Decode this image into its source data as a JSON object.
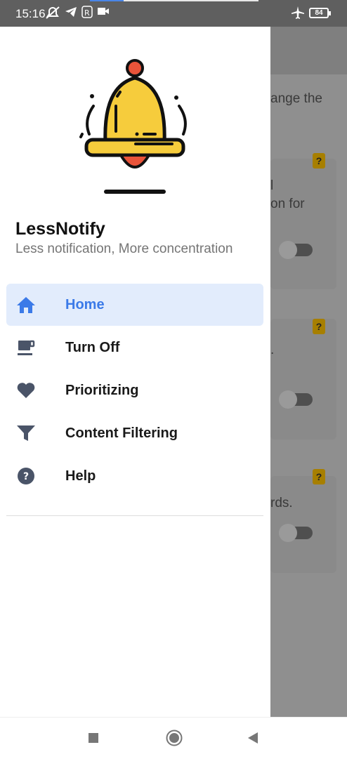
{
  "status_bar": {
    "time": "15:16",
    "icons": [
      "mute-icon",
      "telegram-icon",
      "r-icon",
      "video-icon",
      "airplane-icon",
      "battery-icon"
    ],
    "battery": "84"
  },
  "drawer": {
    "app_name": "LessNotify",
    "tagline": "Less notification, More concentration",
    "accent_color": "#3b7ae8",
    "items": [
      {
        "label": "Home",
        "icon": "home-icon",
        "active": true
      },
      {
        "label": "Turn Off",
        "icon": "coffee-cup-icon",
        "active": false
      },
      {
        "label": "Prioritizing",
        "icon": "heart-icon",
        "active": false
      },
      {
        "label": "Content Filtering",
        "icon": "filter-icon",
        "active": false
      },
      {
        "label": "Help",
        "icon": "help-icon",
        "active": false
      }
    ]
  },
  "background": {
    "text_1": "ange the",
    "text_2": "l",
    "text_3": "on for",
    "text_4": ".",
    "text_5": "rds.",
    "help_badge": "?"
  },
  "nav_bar": {
    "icons": [
      "recents-icon",
      "home-circle-icon",
      "back-icon"
    ]
  }
}
